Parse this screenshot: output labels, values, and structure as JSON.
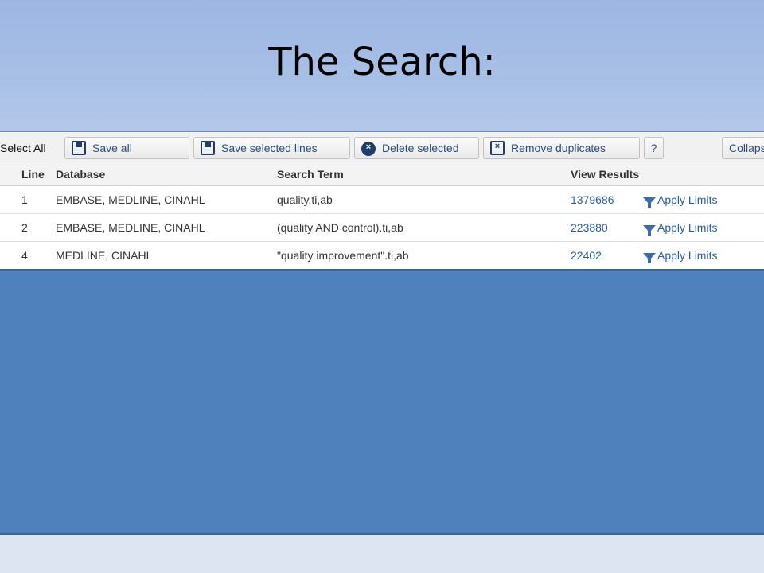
{
  "slide": {
    "title": "The Search:"
  },
  "toolbar": {
    "select_all": "Select All",
    "save_all": "Save all",
    "save_selected": "Save selected lines",
    "delete_selected": "Delete selected",
    "remove_duplicates": "Remove duplicates",
    "help": "?",
    "collapse": "Collaps"
  },
  "table": {
    "headers": {
      "line": "Line",
      "database": "Database",
      "search_term": "Search Term",
      "view_results": "View Results"
    },
    "rows": [
      {
        "line": "1",
        "database": "EMBASE, MEDLINE, CINAHL",
        "term": "quality.ti,ab",
        "results": "1379686",
        "limits": "Apply Limits"
      },
      {
        "line": "2",
        "database": "EMBASE, MEDLINE, CINAHL",
        "term": "(quality AND control).ti,ab",
        "results": "223880",
        "limits": "Apply Limits"
      },
      {
        "line": "4",
        "database": "MEDLINE, CINAHL",
        "term": "\"quality improvement\".ti,ab",
        "results": "22402",
        "limits": "Apply Limits"
      }
    ]
  },
  "colors": {
    "slide_top": "#a9c0e6",
    "slide_mid": "#4f81bd",
    "slide_bottom": "#dde5f3",
    "link": "#2a5d9f"
  },
  "icons": [
    "floppy-disk-icon",
    "x-circle-icon",
    "remove-box-icon",
    "funnel-icon"
  ]
}
